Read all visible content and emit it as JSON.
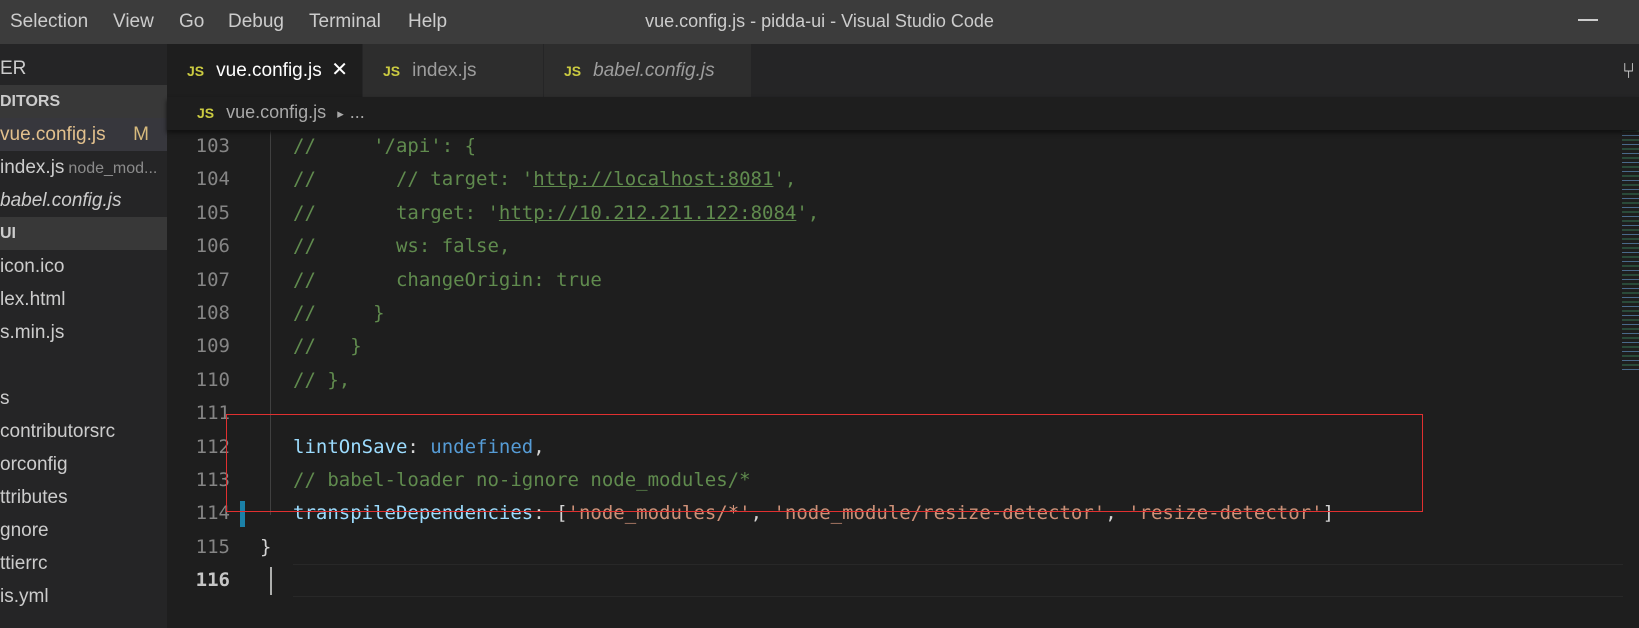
{
  "titlebar": {
    "menu": [
      "Selection",
      "View",
      "Go",
      "Debug",
      "Terminal",
      "Help"
    ],
    "title": "vue.config.js - pidda-ui - Visual Studio Code"
  },
  "sidebar": {
    "items": [
      {
        "label": "ER",
        "type": "plain"
      },
      {
        "label": "DITORS",
        "type": "hdr"
      },
      {
        "label": "vue.config.js",
        "type": "sel",
        "badge": "M"
      },
      {
        "label": "index.js",
        "type": "plain",
        "detail": "node_mod..."
      },
      {
        "label": "babel.config.js",
        "type": "italic"
      },
      {
        "label": "UI",
        "type": "hdr"
      },
      {
        "label": "icon.ico",
        "type": "plain"
      },
      {
        "label": "lex.html",
        "type": "plain"
      },
      {
        "label": "s.min.js",
        "type": "plain"
      },
      {
        "label": "",
        "type": "plain"
      },
      {
        "label": "s",
        "type": "plain"
      },
      {
        "label": "contributorsrc",
        "type": "plain"
      },
      {
        "label": "orconfig",
        "type": "plain"
      },
      {
        "label": "ttributes",
        "type": "plain"
      },
      {
        "label": "gnore",
        "type": "plain"
      },
      {
        "label": "ttierrc",
        "type": "plain"
      },
      {
        "label": "is.yml",
        "type": "plain"
      }
    ]
  },
  "tabs": [
    {
      "label": "vue.config.js",
      "active": true,
      "icon": "JS",
      "close": "✕"
    },
    {
      "label": "index.js",
      "active": false,
      "icon": "JS"
    },
    {
      "label": "babel.config.js",
      "active": false,
      "icon": "JS",
      "italic": true
    }
  ],
  "breadcrumb": {
    "icon": "JS",
    "file": "vue.config.js",
    "sep": "▸",
    "more": "..."
  },
  "colors": {
    "comment": "#608b4e",
    "string": "#ce9178",
    "keyword": "#569cd6",
    "property": "#9cdcfe",
    "highlight_box": "#e03030",
    "git_modified": "#1b81a8"
  },
  "editor": {
    "current_line": 116,
    "lines": [
      {
        "n": "103",
        "tokens": [
          {
            "t": "//     '/api': {",
            "c": "comment"
          }
        ]
      },
      {
        "n": "104",
        "tokens": [
          {
            "t": "//       // target: '",
            "c": "comment"
          },
          {
            "t": "http://localhost:8081",
            "c": "url"
          },
          {
            "t": "',",
            "c": "comment"
          }
        ]
      },
      {
        "n": "105",
        "tokens": [
          {
            "t": "//       target: '",
            "c": "comment"
          },
          {
            "t": "http://10.212.211.122:8084",
            "c": "url"
          },
          {
            "t": "',",
            "c": "comment"
          }
        ]
      },
      {
        "n": "106",
        "tokens": [
          {
            "t": "//       ws: false,",
            "c": "comment"
          }
        ]
      },
      {
        "n": "107",
        "tokens": [
          {
            "t": "//       changeOrigin: true",
            "c": "comment"
          }
        ]
      },
      {
        "n": "108",
        "tokens": [
          {
            "t": "//     }",
            "c": "comment"
          }
        ]
      },
      {
        "n": "109",
        "tokens": [
          {
            "t": "//   }",
            "c": "comment"
          }
        ]
      },
      {
        "n": "110",
        "tokens": [
          {
            "t": "// },",
            "c": "comment"
          }
        ]
      },
      {
        "n": "111",
        "tokens": []
      },
      {
        "n": "112",
        "tokens": [
          {
            "t": "lintOnSave",
            "c": "prop"
          },
          {
            "t": ": ",
            "c": "plain"
          },
          {
            "t": "undefined",
            "c": "kw"
          },
          {
            "t": ",",
            "c": "plain"
          }
        ]
      },
      {
        "n": "113",
        "tokens": [
          {
            "t": "// babel-loader no-ignore node_modules/*",
            "c": "comment"
          }
        ]
      },
      {
        "n": "114",
        "tokens": [
          {
            "t": "transpileDependencies",
            "c": "prop"
          },
          {
            "t": ": [",
            "c": "plain"
          },
          {
            "t": "'node_modules/*'",
            "c": "str"
          },
          {
            "t": ", ",
            "c": "plain"
          },
          {
            "t": "'node_module/resize-detector'",
            "c": "str"
          },
          {
            "t": ", ",
            "c": "plain"
          },
          {
            "t": "'resize-detector'",
            "c": "str"
          },
          {
            "t": "]",
            "c": "plain"
          }
        ]
      },
      {
        "n": "115",
        "tokens": [
          {
            "t": "}",
            "c": "plain"
          }
        ],
        "outdent": true
      },
      {
        "n": "116",
        "tokens": []
      }
    ]
  }
}
